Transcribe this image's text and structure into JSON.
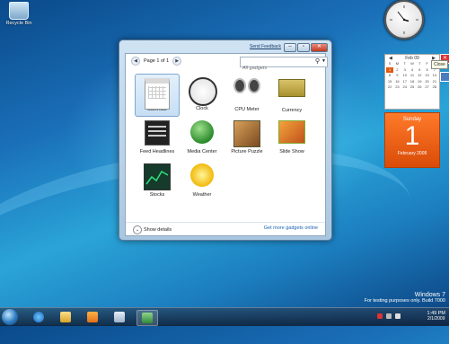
{
  "desktop": {
    "icon_label": "Recycle Bin"
  },
  "gallery": {
    "send_feedback": "Send Feedback",
    "page_indicator": "Page 1 of 1",
    "search_placeholder": "All gadgets",
    "gadgets": [
      {
        "label": "Calendar",
        "selected": true
      },
      {
        "label": "Clock",
        "selected": false
      },
      {
        "label": "CPU Meter",
        "selected": false
      },
      {
        "label": "Currency",
        "selected": false
      },
      {
        "label": "Feed Headlines",
        "selected": false
      },
      {
        "label": "Media Center",
        "selected": false
      },
      {
        "label": "Picture Puzzle",
        "selected": false
      },
      {
        "label": "Slide Show",
        "selected": false
      },
      {
        "label": "Stocks",
        "selected": false
      },
      {
        "label": "Weather",
        "selected": false
      }
    ],
    "show_details": "Show details",
    "get_more": "Get more gadgets online"
  },
  "calendar_gadget": {
    "month_label": "Feb 09",
    "weekdays": [
      "S",
      "M",
      "T",
      "W",
      "T",
      "F",
      "S"
    ],
    "days": [
      "1",
      "2",
      "3",
      "4",
      "5",
      "6",
      "7",
      "8",
      "9",
      "10",
      "11",
      "12",
      "13",
      "14",
      "15",
      "16",
      "17",
      "18",
      "19",
      "20",
      "21",
      "22",
      "23",
      "24",
      "25",
      "26",
      "27",
      "28"
    ],
    "day_name": "Sunday",
    "day_number": "1",
    "month_year": "February 2009"
  },
  "tooltip": "Close",
  "branding": {
    "os": "Windows 7",
    "build": "For testing purposes only. Build 7000"
  },
  "clock": {
    "time": "1:49 PM",
    "date": "2/1/2009"
  },
  "colors": {
    "accent_orange": "#e05a10",
    "window_frame": "#bcd3e8",
    "link_blue": "#1a62b0"
  }
}
